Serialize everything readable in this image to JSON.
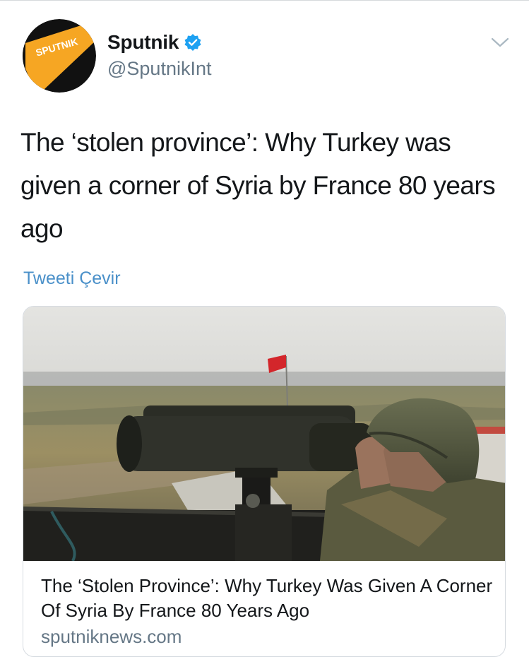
{
  "tweet": {
    "author": {
      "display_name": "Sputnik",
      "handle": "@SputnikInt",
      "verified": true,
      "avatar_text": "SPUTNIK"
    },
    "text": "The ‘stolen province’: Why Turkey was given a corner of Syria by France 80 years ago",
    "translate_label": "Tweeti Çevir",
    "menu_icon": "chevron-down-icon"
  },
  "card": {
    "title": "The ‘Stolen Province’: Why Turkey Was Given A Corner Of Syria By France 80 Years Ago",
    "domain": "sputniknews.com"
  },
  "colors": {
    "verified_badge": "#1da1f2",
    "link": "#4a90c9",
    "secondary_text": "#657786",
    "avatar_orange": "#f6a623",
    "avatar_black": "#111111"
  }
}
